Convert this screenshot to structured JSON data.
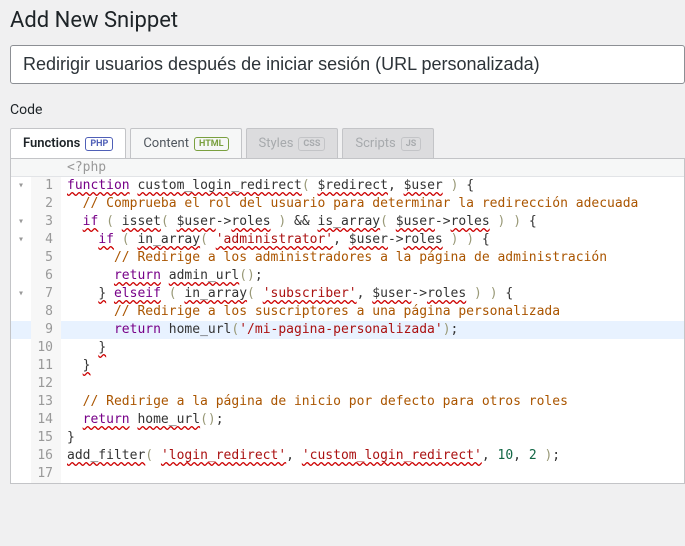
{
  "heading": "Add New Snippet",
  "title_value": "Redirigir usuarios después de iniciar sesión (URL personalizada)",
  "section_label": "Code",
  "tabs": [
    {
      "label": "Functions",
      "badge": "PHP"
    },
    {
      "label": "Content",
      "badge": "HTML"
    },
    {
      "label": "Styles",
      "badge": "CSS"
    },
    {
      "label": "Scripts",
      "badge": "JS"
    }
  ],
  "fixed_line": "<?php",
  "code": {
    "l1_fn": "function",
    "l1_name": "custom_login_redirect",
    "l1_p1": "$redirect",
    "l1_p2": "$user",
    "l2": "// Comprueba el rol del usuario para determinar la redirección adecuada",
    "l3_if": "if",
    "l3_isset": "isset",
    "l3_var": "$user",
    "l3_roles": "roles",
    "l3_and": "&&",
    "l3_isarr": "is_array",
    "l4_if": "if",
    "l4_inarr": "in_array",
    "l4_str": "'administrator'",
    "l4_var": "$user",
    "l4_roles": "roles",
    "l5": "// Redirige a los administradores a la página de administración",
    "l6_ret": "return",
    "l6_fn": "admin_url",
    "l7_elseif": "elseif",
    "l7_inarr": "in_array",
    "l7_str": "'subscriber'",
    "l7_var": "$user",
    "l7_roles": "roles",
    "l8": "// Redirige a los suscriptores a una página personalizada",
    "l9_ret": "return",
    "l9_fn": "home_url",
    "l9_str": "'/mi-pagina-personalizada'",
    "l13": "// Redirige a la página de inicio por defecto para otros roles",
    "l14_ret": "return",
    "l14_fn": "home_url",
    "l16_fn": "add_filter",
    "l16_s1": "'login_redirect'",
    "l16_s2": "'custom_login_redirect'",
    "l16_n1": "10",
    "l16_n2": "2"
  }
}
